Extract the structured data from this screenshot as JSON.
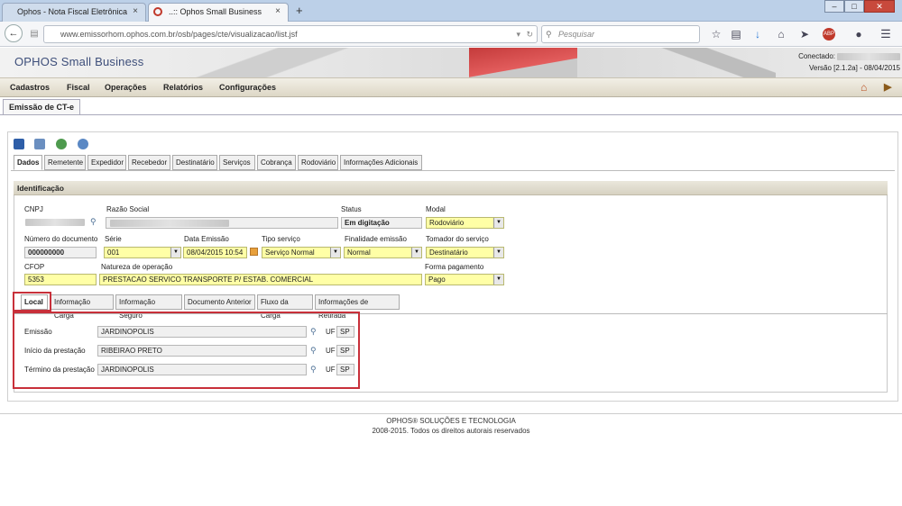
{
  "browser": {
    "tabs": [
      {
        "title": "Ophos - Nota Fiscal Eletrônica",
        "close": "×"
      },
      {
        "title": "..:: Ophos Small Business",
        "close": "×"
      }
    ],
    "new_tab": "+",
    "url": "www.emissorhom.ophos.com.br/osb/pages/cte/visualizacao/list.jsf",
    "search_placeholder": "Pesquisar",
    "window_buttons": {
      "minimize": "–",
      "maximize": "□",
      "close": "✕"
    }
  },
  "app": {
    "brand": "OPHOS Small Business",
    "conectado_label": "Conectado:",
    "version": "Versão [2.1.2a] - 08/04/2015",
    "menu": [
      "Cadastros",
      "Fiscal",
      "Operações",
      "Relatórios",
      "Configurações"
    ],
    "page_tab": "Emissão de CT-e"
  },
  "tabs": [
    "Dados",
    "Remetente",
    "Expedidor",
    "Recebedor",
    "Destinatário",
    "Serviços",
    "Cobrança",
    "Rodoviário",
    "Informações Adicionais"
  ],
  "identificacao": {
    "title": "Identificação",
    "labels": {
      "cnpj": "CNPJ",
      "razao_social": "Razão Social",
      "status": "Status",
      "modal": "Modal",
      "numero": "Número do documento",
      "serie": "Série",
      "data_emissao": "Data Emissão",
      "tipo_servico": "Tipo serviço",
      "finalidade": "Finalidade emissão",
      "tomador": "Tomador do serviço",
      "cfop": "CFOP",
      "natureza": "Natureza de operação",
      "forma_pagamento": "Forma pagamento"
    },
    "values": {
      "status": "Em digitação",
      "modal": "Rodoviário",
      "numero": "000000000",
      "serie": "001",
      "data_emissao": "08/04/2015 10:54",
      "tipo_servico": "Serviço Normal",
      "finalidade": "Normal",
      "tomador": "Destinatário",
      "cfop": "5353",
      "natureza": "PRESTACAO SERVICO TRANSPORTE P/ ESTAB. COMERCIAL",
      "forma_pagamento": "Pago"
    }
  },
  "subtabs": [
    "Local",
    "Informação Carga",
    "Informação Seguro",
    "Documento Anterior",
    "Fluxo da Carga",
    "Informações de Retirada"
  ],
  "local": {
    "uf_label": "UF",
    "rows": [
      {
        "label": "Emissão",
        "city": "JARDINOPOLIS",
        "uf": "SP"
      },
      {
        "label": "Início da prestação",
        "city": "RIBEIRAO PRETO",
        "uf": "SP"
      },
      {
        "label": "Término da prestação",
        "city": "JARDINOPOLIS",
        "uf": "SP"
      }
    ]
  },
  "footer": {
    "line1": "OPHOS® SOLUÇÕES E TECNOLOGIA",
    "line2": "2008-2015. Todos os direitos autorais reservados"
  }
}
